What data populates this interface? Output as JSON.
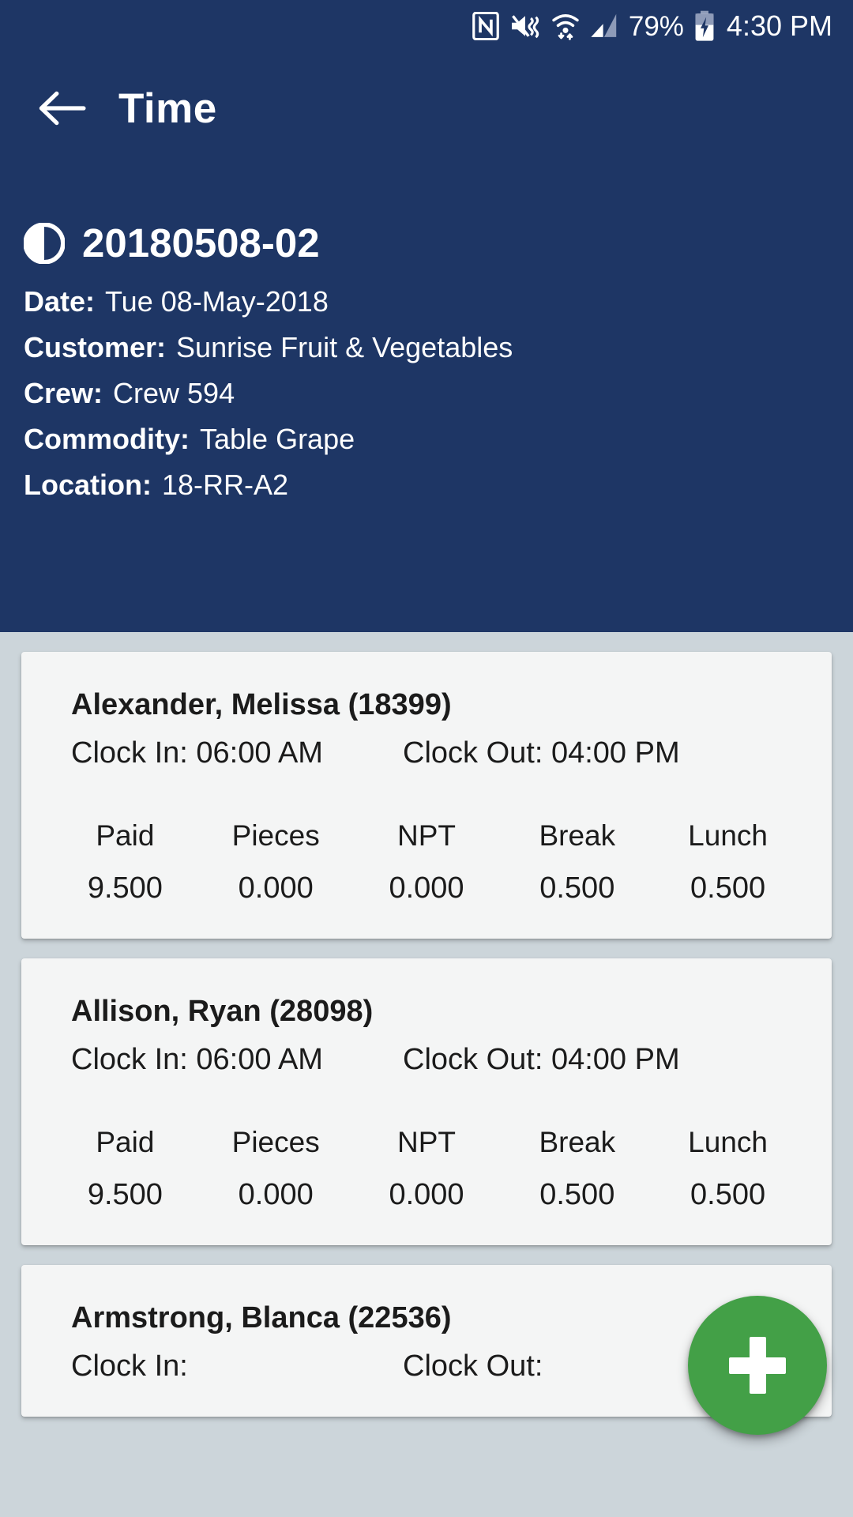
{
  "statusbar": {
    "icons": [
      "nfc-icon",
      "mute-vibrate-icon",
      "wifi-icon",
      "cellular-signal-icon"
    ],
    "battery_percent": "79%",
    "battery_state": "charging",
    "clock": "4:30 PM"
  },
  "toolbar": {
    "back_icon": "arrow-left-icon",
    "title": "Time"
  },
  "job": {
    "status_icon": "half-circle-icon",
    "id": "20180508-02",
    "fields": [
      {
        "label": "Date:",
        "value": "Tue 08-May-2018"
      },
      {
        "label": "Customer:",
        "value": "Sunrise Fruit & Vegetables"
      },
      {
        "label": "Crew:",
        "value": "Crew 594"
      },
      {
        "label": "Commodity:",
        "value": "Table Grape"
      },
      {
        "label": "Location:",
        "value": "18-RR-A2"
      }
    ]
  },
  "list": {
    "clock_in_label": "Clock In:",
    "clock_out_label": "Clock Out:",
    "metric_headers": [
      "Paid",
      "Pieces",
      "NPT",
      "Break",
      "Lunch"
    ],
    "entries": [
      {
        "name": "Alexander, Melissa (18399)",
        "clock_in": "06:00 AM",
        "clock_out": "04:00 PM",
        "metrics": [
          "9.500",
          "0.000",
          "0.000",
          "0.500",
          "0.500"
        ]
      },
      {
        "name": "Allison, Ryan (28098)",
        "clock_in": "06:00 AM",
        "clock_out": "04:00 PM",
        "metrics": [
          "9.500",
          "0.000",
          "0.000",
          "0.500",
          "0.500"
        ]
      },
      {
        "name": "Armstrong, Blanca (22536)",
        "clock_in": "",
        "clock_out": "",
        "metrics": [
          "",
          "",
          "",
          "",
          ""
        ]
      }
    ]
  },
  "fab": {
    "icon": "plus-icon",
    "color": "#43a047"
  },
  "colors": {
    "header_blue": "#1e3665",
    "page_background": "#ccd5da",
    "card_background": "#f4f5f5",
    "accent_green": "#43a047",
    "text_dark": "#1b1b1b",
    "text_light": "#ffffff"
  }
}
